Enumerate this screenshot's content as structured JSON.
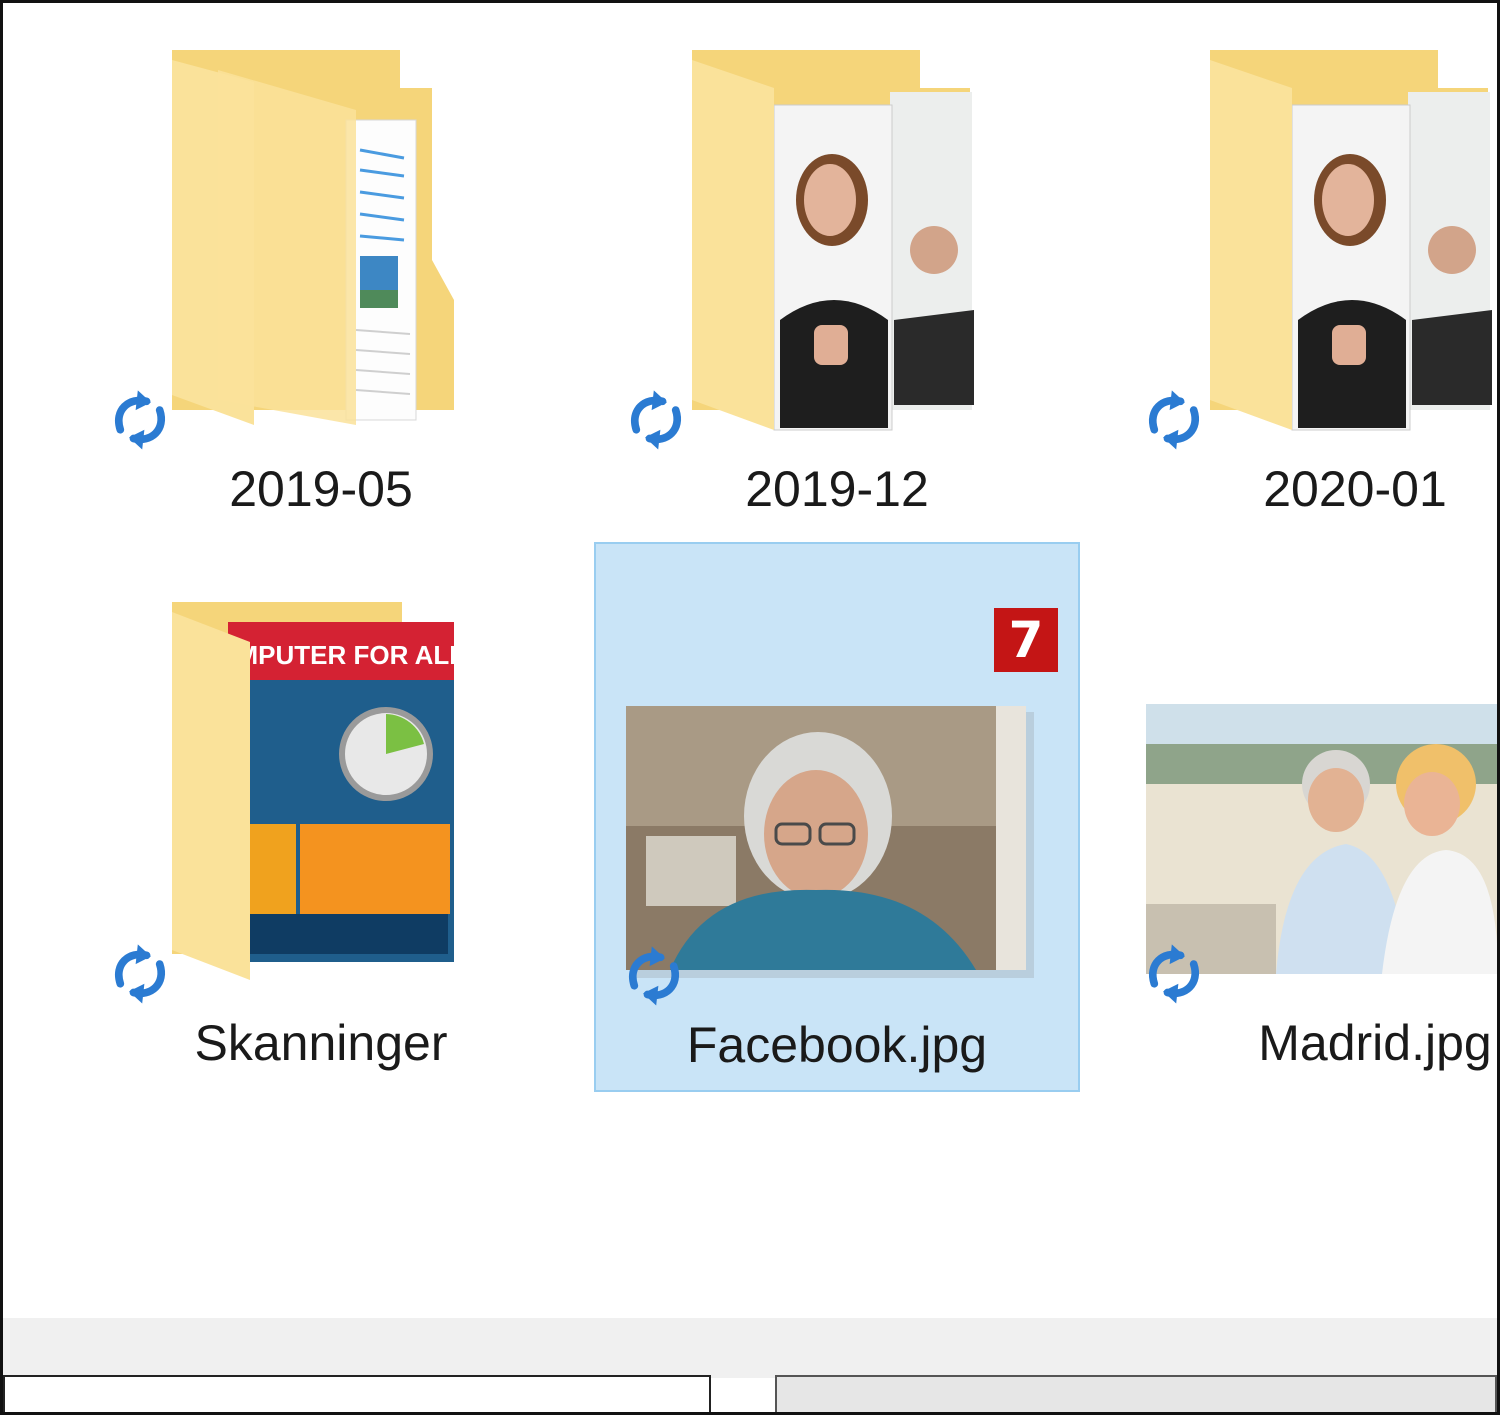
{
  "colors": {
    "folder_back": "#f5d57a",
    "folder_front": "#fae29a",
    "sync_blue": "#2b7bd2",
    "selection_bg": "#c9e4f7",
    "selection_border": "#99cdf0",
    "badge_red": "#c41515"
  },
  "items": [
    {
      "label": "2019-05",
      "type": "folder",
      "preview": "document-pages",
      "status_icon": "sync-icon",
      "selected": false
    },
    {
      "label": "2019-12",
      "type": "folder",
      "preview": "portrait-photos",
      "status_icon": "sync-icon",
      "selected": false
    },
    {
      "label": "2020-01",
      "type": "folder",
      "preview": "portrait-photos",
      "status_icon": "sync-icon",
      "selected": false
    },
    {
      "label": "Skanninger",
      "type": "folder",
      "preview": "magazine-cover",
      "cover_text": "KOMPUTER FOR ALLE",
      "status_icon": "sync-icon",
      "selected": false
    },
    {
      "label": "Facebook.jpg",
      "type": "image",
      "preview": "man-portrait-photo",
      "status_icon": "sync-icon",
      "selected": true,
      "badge": "7"
    },
    {
      "label": "Madrid.jpg",
      "type": "image",
      "preview": "couple-beach-photo",
      "status_icon": "sync-icon",
      "selected": false
    }
  ]
}
